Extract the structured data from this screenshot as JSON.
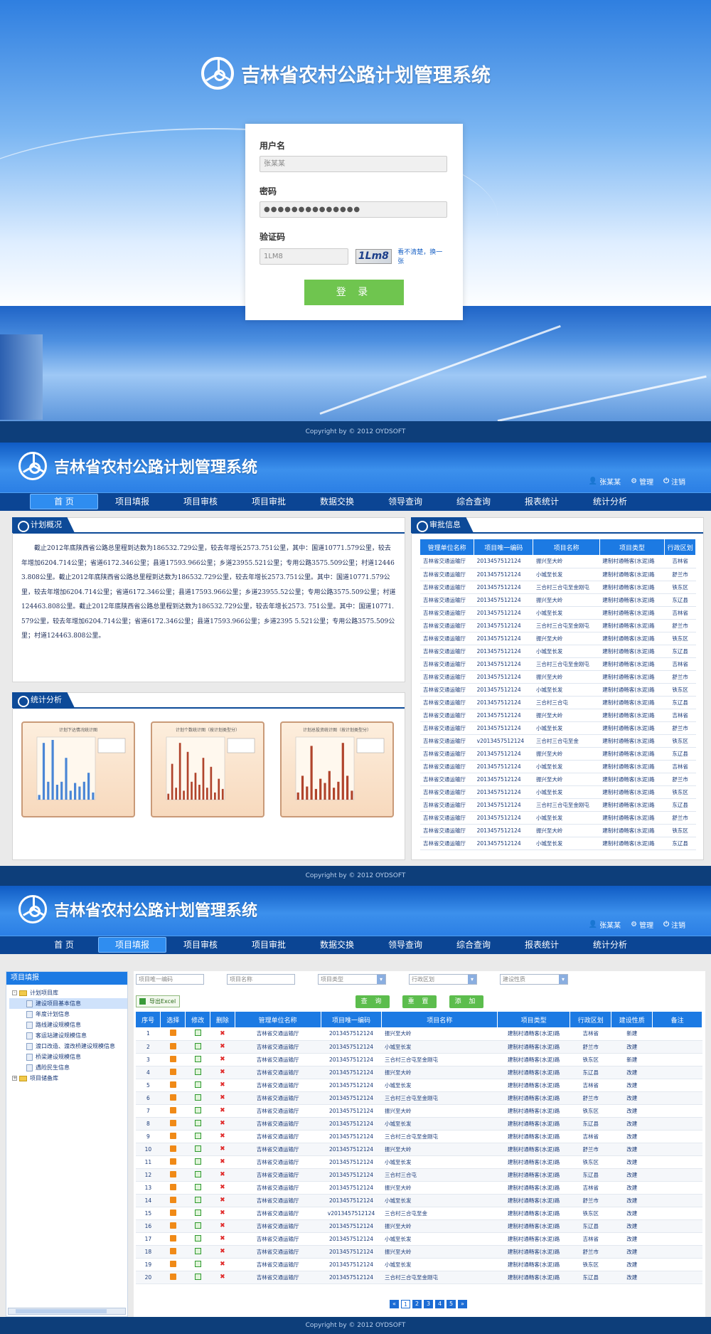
{
  "app_title": "吉林省农村公路计划管理系统",
  "copyright": "Copyright by © 2012 OYDSOFT",
  "login": {
    "username_label": "用户名",
    "username_value": "张某某",
    "password_label": "密码",
    "password_value": "●●●●●●●●●●●●●●",
    "captcha_label": "验证码",
    "captcha_value": "1LM8",
    "captcha_image_text": "1Lm8",
    "captcha_link": "看不清楚，换一张",
    "submit": "登 录"
  },
  "user_bar": {
    "user": "张某某",
    "manage": "管理",
    "logout": "注销"
  },
  "nav": [
    "首 页",
    "项目填报",
    "项目审核",
    "项目审批",
    "数据交换",
    "领导查询",
    "综合查询",
    "报表统计",
    "统计分析"
  ],
  "home": {
    "overview_title": "计划概况",
    "overview_text": "截止2012年底陕西省公路总里程到达数为186532.729公里，较去年增长2573.751公里，其中：国道10771.579公里，较去年增加6204.714公里；省道6172.346公里；县道17593.966公里；乡道23955.521公里；专用公路3575.509公里；村道124463.808公里。截止2012年底陕西省公路总里程到达数为186532.729公里，较去年增长2573.751公里。其中：国道10771.579公里，较去年增加6204.714公里；省道6172.346公里；县道17593.966公里；乡道23955.52公里；专用公路3575.509公里；村道124463.808公里。截止2012年底陕西省公路总里程到达数为186532.729公里，较去年增长2573. 751公里。其中：国道10771.579公里，较去年增加6204.714公里；省道6172.346公里；县道17593.966公里；乡道2395 5.521公里；专用公路3575.509公里；村道124463.808公里。",
    "stats_title": "统计分析",
    "charts": [
      {
        "title": "计划下达情况统计图",
        "bars": [
          8,
          95,
          30,
          100,
          25,
          30,
          70,
          15,
          28,
          22,
          30,
          45,
          12
        ],
        "color": "#4a86d6"
      },
      {
        "title": "计划个数统计图（按计划类型分）",
        "bars": [
          10,
          60,
          20,
          95,
          15,
          80,
          30,
          45,
          25,
          70,
          20,
          55,
          12,
          35,
          18
        ],
        "color": "#b0442c"
      },
      {
        "title": "计划总投资统计图（按计划类型分）",
        "bars": [
          12,
          40,
          22,
          90,
          18,
          35,
          28,
          48,
          20,
          30,
          95,
          40,
          15
        ],
        "color": "#b0442c"
      }
    ],
    "audit_title": "审批信息",
    "audit_headers": [
      "管理单位名称",
      "项目唯一编码",
      "项目名称",
      "项目类型",
      "行政区划"
    ],
    "audit_rows": [
      [
        "吉林省交通运输厅",
        "2013457512124",
        "振兴至大岭",
        "建制村通畅客(水泥)路",
        "吉林省"
      ],
      [
        "吉林省交通运输厅",
        "2013457512124",
        "小城至长发",
        "建制村通畅客(水泥)路",
        "舒兰市"
      ],
      [
        "吉林省交通运输厅",
        "2013457512124",
        "三合村三合屯至金刚屯",
        "建制村通畅客(水泥)路",
        "铁东区"
      ],
      [
        "吉林省交通运输厅",
        "2013457512124",
        "振兴至大岭",
        "建制村通畅客(水泥)路",
        "东辽县"
      ],
      [
        "吉林省交通运输厅",
        "2013457512124",
        "小城至长发",
        "建制村通畅客(水泥)路",
        "吉林省"
      ],
      [
        "吉林省交通运输厅",
        "2013457512124",
        "三合村三合屯至金刚屯",
        "建制村通畅客(水泥)路",
        "舒兰市"
      ],
      [
        "吉林省交通运输厅",
        "2013457512124",
        "振兴至大岭",
        "建制村通畅客(水泥)路",
        "铁东区"
      ],
      [
        "吉林省交通运输厅",
        "2013457512124",
        "小城至长发",
        "建制村通畅客(水泥)路",
        "东辽县"
      ],
      [
        "吉林省交通运输厅",
        "2013457512124",
        "三合村三合屯至金刚屯",
        "建制村通畅客(水泥)路",
        "吉林省"
      ],
      [
        "吉林省交通运输厅",
        "2013457512124",
        "振兴至大岭",
        "建制村通畅客(水泥)路",
        "舒兰市"
      ],
      [
        "吉林省交通运输厅",
        "2013457512124",
        "小城至长发",
        "建制村通畅客(水泥)路",
        "铁东区"
      ],
      [
        "吉林省交通运输厅",
        "2013457512124",
        "三合村三合屯",
        "建制村通畅客(水泥)路",
        "东辽县"
      ],
      [
        "吉林省交通运输厅",
        "2013457512124",
        "振兴至大岭",
        "建制村通畅客(水泥)路",
        "吉林省"
      ],
      [
        "吉林省交通运输厅",
        "2013457512124",
        "小城至长发",
        "建制村通畅客(水泥)路",
        "舒兰市"
      ],
      [
        "吉林省交通运输厅",
        "v2013457512124",
        "三合村三合屯至金",
        "建制村通畅客(水泥)路",
        "铁东区"
      ],
      [
        "吉林省交通运输厅",
        "2013457512124",
        "振兴至大岭",
        "建制村通畅客(水泥)路",
        "东辽县"
      ],
      [
        "吉林省交通运输厅",
        "2013457512124",
        "小城至长发",
        "建制村通畅客(水泥)路",
        "吉林省"
      ],
      [
        "吉林省交通运输厅",
        "2013457512124",
        "振兴至大岭",
        "建制村通畅客(水泥)路",
        "舒兰市"
      ],
      [
        "吉林省交通运输厅",
        "2013457512124",
        "小城至长发",
        "建制村通畅客(水泥)路",
        "铁东区"
      ],
      [
        "吉林省交通运输厅",
        "2013457512124",
        "三合村三合屯至金刚屯",
        "建制村通畅客(水泥)路",
        "东辽县"
      ],
      [
        "吉林省交通运输厅",
        "2013457512124",
        "小城至长发",
        "建制村通畅客(水泥)路",
        "舒兰市"
      ],
      [
        "吉林省交通运输厅",
        "2013457512124",
        "振兴至大岭",
        "建制村通畅客(水泥)路",
        "铁东区"
      ],
      [
        "吉林省交通运输厅",
        "2013457512124",
        "小城至长发",
        "建制村通畅客(水泥)路",
        "东辽县"
      ]
    ]
  },
  "fill": {
    "sidebar_title": "项目填报",
    "tree": [
      {
        "label": "计划项目库",
        "type": "folder",
        "level": 0,
        "toggle": "-"
      },
      {
        "label": "建设项目基本信息",
        "type": "doc",
        "level": 1,
        "selected": true
      },
      {
        "label": "年度计划信息",
        "type": "doc",
        "level": 1
      },
      {
        "label": "路线建设规模信息",
        "type": "doc",
        "level": 1
      },
      {
        "label": "客运站建设规模信息",
        "type": "doc",
        "level": 1
      },
      {
        "label": "渡口改造、渡改桥建设规模信息",
        "type": "doc",
        "level": 1
      },
      {
        "label": "桥梁建设规模信息",
        "type": "doc",
        "level": 1
      },
      {
        "label": "遇险民生信息",
        "type": "doc",
        "level": 1
      },
      {
        "label": "项目储备库",
        "type": "folder",
        "level": 0,
        "toggle": "+"
      }
    ],
    "filters": [
      {
        "placeholder": "项目唯一编码",
        "select": false
      },
      {
        "placeholder": "项目名称",
        "select": false
      },
      {
        "placeholder": "项目类型",
        "select": true
      },
      {
        "placeholder": "行政区划",
        "select": true
      },
      {
        "placeholder": "建设性质",
        "select": true
      }
    ],
    "export": "导出Excel",
    "buttons": [
      "查 询",
      "重 置",
      "添 加"
    ],
    "headers": [
      "序号",
      "选择",
      "修改",
      "删除",
      "管理单位名称",
      "项目唯一编码",
      "项目名称",
      "项目类型",
      "行政区划",
      "建设性质",
      "备注"
    ],
    "rows": [
      [
        "1",
        "吉林省交通运输厅",
        "2013457512124",
        "振兴至大岭",
        "建制村通畅客(水泥)路",
        "吉林省",
        "新建"
      ],
      [
        "2",
        "吉林省交通运输厅",
        "2013457512124",
        "小城至长发",
        "建制村通畅客(水泥)路",
        "舒兰市",
        "改建"
      ],
      [
        "3",
        "吉林省交通运输厅",
        "2013457512124",
        "三合村三合屯至金刚屯",
        "建制村通畅客(水泥)路",
        "铁东区",
        "新建"
      ],
      [
        "4",
        "吉林省交通运输厅",
        "2013457512124",
        "振兴至大岭",
        "建制村通畅客(水泥)路",
        "东辽县",
        "改建"
      ],
      [
        "5",
        "吉林省交通运输厅",
        "2013457512124",
        "小城至长发",
        "建制村通畅客(水泥)路",
        "吉林省",
        "改建"
      ],
      [
        "6",
        "吉林省交通运输厅",
        "2013457512124",
        "三合村三合屯至金刚屯",
        "建制村通畅客(水泥)路",
        "舒兰市",
        "改建"
      ],
      [
        "7",
        "吉林省交通运输厅",
        "2013457512124",
        "振兴至大岭",
        "建制村通畅客(水泥)路",
        "铁东区",
        "改建"
      ],
      [
        "8",
        "吉林省交通运输厅",
        "2013457512124",
        "小城至长发",
        "建制村通畅客(水泥)路",
        "东辽县",
        "改建"
      ],
      [
        "9",
        "吉林省交通运输厅",
        "2013457512124",
        "三合村三合屯至金刚屯",
        "建制村通畅客(水泥)路",
        "吉林省",
        "改建"
      ],
      [
        "10",
        "吉林省交通运输厅",
        "2013457512124",
        "振兴至大岭",
        "建制村通畅客(水泥)路",
        "舒兰市",
        "改建"
      ],
      [
        "11",
        "吉林省交通运输厅",
        "2013457512124",
        "小城至长发",
        "建制村通畅客(水泥)路",
        "铁东区",
        "改建"
      ],
      [
        "12",
        "吉林省交通运输厅",
        "2013457512124",
        "三合村三合屯",
        "建制村通畅客(水泥)路",
        "东辽县",
        "改建"
      ],
      [
        "13",
        "吉林省交通运输厅",
        "2013457512124",
        "振兴至大岭",
        "建制村通畅客(水泥)路",
        "吉林省",
        "改建"
      ],
      [
        "14",
        "吉林省交通运输厅",
        "2013457512124",
        "小城至长发",
        "建制村通畅客(水泥)路",
        "舒兰市",
        "改建"
      ],
      [
        "15",
        "吉林省交通运输厅",
        "v2013457512124",
        "三合村三合屯至金",
        "建制村通畅客(水泥)路",
        "铁东区",
        "改建"
      ],
      [
        "16",
        "吉林省交通运输厅",
        "2013457512124",
        "振兴至大岭",
        "建制村通畅客(水泥)路",
        "东辽县",
        "改建"
      ],
      [
        "17",
        "吉林省交通运输厅",
        "2013457512124",
        "小城至长发",
        "建制村通畅客(水泥)路",
        "吉林省",
        "改建"
      ],
      [
        "18",
        "吉林省交通运输厅",
        "2013457512124",
        "振兴至大岭",
        "建制村通畅客(水泥)路",
        "舒兰市",
        "改建"
      ],
      [
        "19",
        "吉林省交通运输厅",
        "2013457512124",
        "小城至长发",
        "建制村通畅客(水泥)路",
        "铁东区",
        "改建"
      ],
      [
        "20",
        "吉林省交通运输厅",
        "2013457512124",
        "三合村三合屯至金刚屯",
        "建制村通畅客(水泥)路",
        "东辽县",
        "改建"
      ]
    ],
    "pager": [
      "«",
      "1",
      "2",
      "3",
      "4",
      "5",
      "»"
    ]
  }
}
